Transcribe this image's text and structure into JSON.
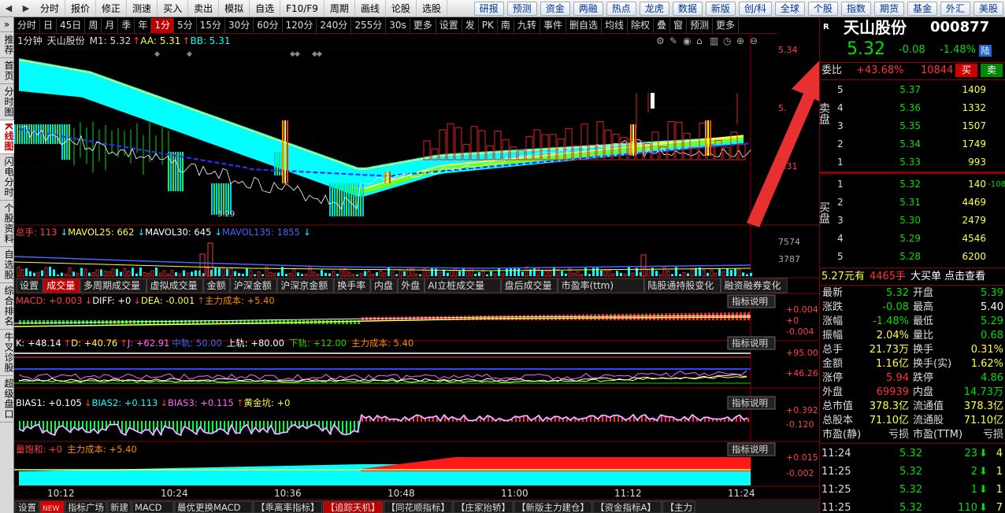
{
  "toolbar": {
    "items": [
      "分时",
      "报价",
      "修正",
      "测速",
      "买入",
      "卖出",
      "模拟",
      "自选",
      "F10/F9",
      "周期",
      "画线",
      "论股",
      "选股"
    ],
    "right_items": [
      "研报",
      "预测",
      "资金",
      "两融",
      "热点",
      "龙虎",
      "数据",
      "新版",
      "创/科",
      "全球",
      "个股",
      "指数",
      "期货",
      "基金",
      "外汇",
      "美股"
    ]
  },
  "leftnav": [
    "推荐",
    "首页",
    "分时图",
    "K线图",
    "闪电分时",
    "个股资料",
    "自选股",
    "综合排名",
    "牛叉诊股",
    "超级盘口"
  ],
  "periods": [
    "分时",
    "日",
    "45日",
    "周",
    "月",
    "季",
    "年",
    "1分",
    "5分",
    "15分",
    "30分",
    "60分",
    "120分",
    "240分",
    "255分",
    "30s",
    "更多",
    "设置",
    "发",
    "PK",
    "南",
    "九转",
    "事件",
    "删自选",
    "均线",
    "除权",
    "叠",
    "窗",
    "预测",
    "更多"
  ],
  "price_panel": {
    "title": "1分钟",
    "stock": "天山股份",
    "m1": "M1: 5.32",
    "aa": "AA: 5.31",
    "bb": "BB: 5.31",
    "axis": [
      "5.34",
      "5.",
      "5.31"
    ],
    "low_label": "5.29"
  },
  "volume_panel": {
    "total": "总手: 113",
    "mavol25": "MAVOL25: 662",
    "mavol30": "MAVOL30: 645",
    "mavol135": "MAVOL135: 1855",
    "axis": [
      "7574",
      "3787"
    ]
  },
  "indicator_tabs": [
    "设置",
    "成交量",
    "多周期成交量",
    "虚拟成交量",
    "金额",
    "沪深金额",
    "沪深京金额",
    "换手率",
    "内盘",
    "外盘",
    "AI立桩成交量",
    "盘后成交量",
    "市盈率(ttm)",
    "陆股通持股变化",
    "融资融券变化"
  ],
  "macd": {
    "macd": "MACD: +0.003",
    "diff": "DIFF: +0",
    "dea": "DEA: -0.001",
    "main": "主力成本: +5.40",
    "btn": "指标说明",
    "axis": [
      "+0.004",
      "+0",
      "-0.004"
    ]
  },
  "kdj": {
    "k": "K: +48.14",
    "d": "D: +40.76",
    "j": "J: +62.91",
    "mid": "中轨: 50.00",
    "upper": "上轨: +80.00",
    "lower": "下轨: +12.00",
    "main": "主力成本: 5.40",
    "btn": "指标说明",
    "axis": [
      "+95.00",
      "+46.26"
    ]
  },
  "bias": {
    "b1": "BIAS1: +0.105",
    "b2": "BIAS2: +0.113",
    "b3": "BIAS3: +0.115",
    "gold": "黄金坑: +0",
    "btn": "指标说明",
    "axis": [
      "+0.392",
      "-0.120"
    ]
  },
  "saturation": {
    "sat": "量饱和: +0",
    "main": "主力成本: +5.40",
    "btn": "指标说明",
    "axis": [
      "+0.015",
      "-0.002"
    ]
  },
  "time_axis": [
    "10:12",
    "10:24",
    "10:36",
    "10:48",
    "11:00",
    "11:12",
    "11:24"
  ],
  "bottom_tabs": [
    "设置",
    "NEW",
    "指标广场",
    "新建",
    "MACD",
    "最优更换MACD",
    "【乖离率指标】",
    "【追踪天机】",
    "【同花顺指标】",
    "【庄家抬轿】",
    "【新版主力建仓】",
    "【资金指标A】",
    "【主力"
  ],
  "quote": {
    "r_label": "R",
    "name": "天山股份",
    "code": "000877",
    "price": "5.32",
    "change": "-0.08",
    "pct": "-1.48%",
    "lu": "陆",
    "wb_label": "委比",
    "wb_value": "+43.68%",
    "wb_diff": "10844",
    "buy_btn": "买",
    "sell_btn": "卖",
    "sell_label": "卖盘",
    "buy_label": "买盘",
    "asks": [
      {
        "n": "5",
        "p": "5.37",
        "v": "1409"
      },
      {
        "n": "4",
        "p": "5.36",
        "v": "1332"
      },
      {
        "n": "3",
        "p": "5.35",
        "v": "1507"
      },
      {
        "n": "2",
        "p": "5.34",
        "v": "1749"
      },
      {
        "n": "1",
        "p": "5.33",
        "v": "993"
      }
    ],
    "bids": [
      {
        "n": "1",
        "p": "5.32",
        "v": "140",
        "c": "-108"
      },
      {
        "n": "2",
        "p": "5.31",
        "v": "4469",
        "c": ""
      },
      {
        "n": "3",
        "p": "5.30",
        "v": "2479",
        "c": ""
      },
      {
        "n": "4",
        "p": "5.29",
        "v": "4546",
        "c": ""
      },
      {
        "n": "5",
        "p": "5.28",
        "v": "6200",
        "c": ""
      }
    ],
    "big_order": {
      "price": "5.27元有",
      "vol": "4465手",
      "text": "大买单 点击查看"
    },
    "stats": [
      {
        "l1": "最新",
        "v1": "5.32",
        "c1": "#00dd00",
        "l2": "开盘",
        "v2": "5.39",
        "c2": "#00dd00"
      },
      {
        "l1": "涨跌",
        "v1": "-0.08",
        "c1": "#00dd00",
        "l2": "最高",
        "v2": "5.40",
        "c2": "#ffffff"
      },
      {
        "l1": "涨幅",
        "v1": "-1.48%",
        "c1": "#00dd00",
        "l2": "最低",
        "v2": "5.29",
        "c2": "#00dd00"
      },
      {
        "l1": "振幅",
        "v1": "2.04%",
        "c1": "#ffff44",
        "l2": "量比",
        "v2": "0.68",
        "c2": "#00dd00"
      },
      {
        "l1": "总手",
        "v1": "21.73万",
        "c1": "#ffff44",
        "l2": "换手",
        "v2": "0.31%",
        "c2": "#ffff44"
      },
      {
        "l1": "金额",
        "v1": "1.16亿",
        "c1": "#ffff44",
        "l2": "换手(实)",
        "v2": "1.62%",
        "c2": "#ffff44"
      },
      {
        "l1": "涨停",
        "v1": "5.94",
        "c1": "#ff3333",
        "l2": "跌停",
        "v2": "4.86",
        "c2": "#00dd00"
      },
      {
        "l1": "外盘",
        "v1": "69939",
        "c1": "#ff3333",
        "l2": "内盘",
        "v2": "14.73万",
        "c2": "#00dd00"
      },
      {
        "l1": "总市值",
        "v1": "378.3亿",
        "c1": "#ffff44",
        "l2": "流通值",
        "v2": "378.3亿",
        "c2": "#ffff44"
      },
      {
        "l1": "总股本",
        "v1": "71.10亿",
        "c1": "#ffff44",
        "l2": "流通股",
        "v2": "71.10亿",
        "c2": "#ffff44"
      },
      {
        "l1": "市盈(静)",
        "v1": "亏损",
        "c1": "#ddd",
        "l2": "市盈(TTM)",
        "v2": "亏损",
        "c2": "#ddd"
      }
    ],
    "ticks": [
      {
        "t": "11:24",
        "p": "5.32",
        "v": "23",
        "a": "down",
        "n": "4"
      },
      {
        "t": "11:25",
        "p": "5.32",
        "v": "2",
        "a": "down",
        "n": "1"
      },
      {
        "t": "11:25",
        "p": "5.32",
        "v": "1",
        "a": "down",
        "n": "1"
      },
      {
        "t": "11:25",
        "p": "5.32",
        "v": "110",
        "a": "down",
        "n": "7"
      }
    ]
  },
  "colors": {
    "up": "#ff3333",
    "down": "#00dd00",
    "cyan": "#00ffff",
    "yellow": "#ffff44",
    "blue": "#3333ff",
    "arrow": "#e83030"
  }
}
